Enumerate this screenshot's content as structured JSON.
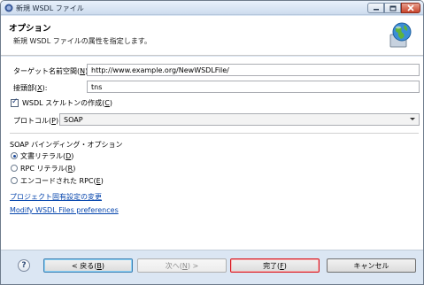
{
  "window": {
    "title": "新規 WSDL ファイル"
  },
  "header": {
    "title": "オプション",
    "description": "新規 WSDL ファイルの属性を指定します。"
  },
  "form": {
    "namespace_label": "ターゲット名前空間(",
    "namespace_mnemonic": "N",
    "namespace_label_end": "):",
    "namespace_value": "http://www.example.org/NewWSDLFile/",
    "prefix_label": "接頭部(",
    "prefix_mnemonic": "X",
    "prefix_label_end": "):",
    "prefix_value": "tns",
    "skeleton_label": "WSDL スケルトンの作成(",
    "skeleton_mnemonic": "C",
    "skeleton_label_end": ")",
    "skeleton_checked": true,
    "protocol_label": "プロトコル(",
    "protocol_mnemonic": "P",
    "protocol_label_end": "):",
    "protocol_value": "SOAP"
  },
  "binding": {
    "group_label": "SOAP バインディング・オプション",
    "options": [
      {
        "label": "文書リテラル(",
        "mnemonic": "D",
        "end": ")",
        "selected": true
      },
      {
        "label": "RPC リテラル(",
        "mnemonic": "R",
        "end": ")",
        "selected": false
      },
      {
        "label": "エンコードされた RPC(",
        "mnemonic": "E",
        "end": ")",
        "selected": false
      }
    ]
  },
  "links": {
    "project_settings": "プロジェクト固有設定の変更",
    "preferences": "Modify WSDL Files preferences"
  },
  "buttons": {
    "help": "?",
    "back": "< 戻る(",
    "back_mnemonic": "B",
    "back_end": ")",
    "next": "次へ(",
    "next_mnemonic": "N",
    "next_end": ") >",
    "finish": "完了(",
    "finish_mnemonic": "F",
    "finish_end": ")",
    "cancel": "キャンセル"
  },
  "colors": {
    "title_bar": "#dbe6f3",
    "link": "#0645ad",
    "finish_border": "#d9141c",
    "default_button_border": "#3c7fb1"
  },
  "icons": {
    "app": "eclipse-app-icon",
    "wizard": "globe-wizard-icon",
    "minimize": "minimize-icon",
    "maximize": "maximize-icon",
    "close": "close-icon",
    "help": "help-icon"
  }
}
